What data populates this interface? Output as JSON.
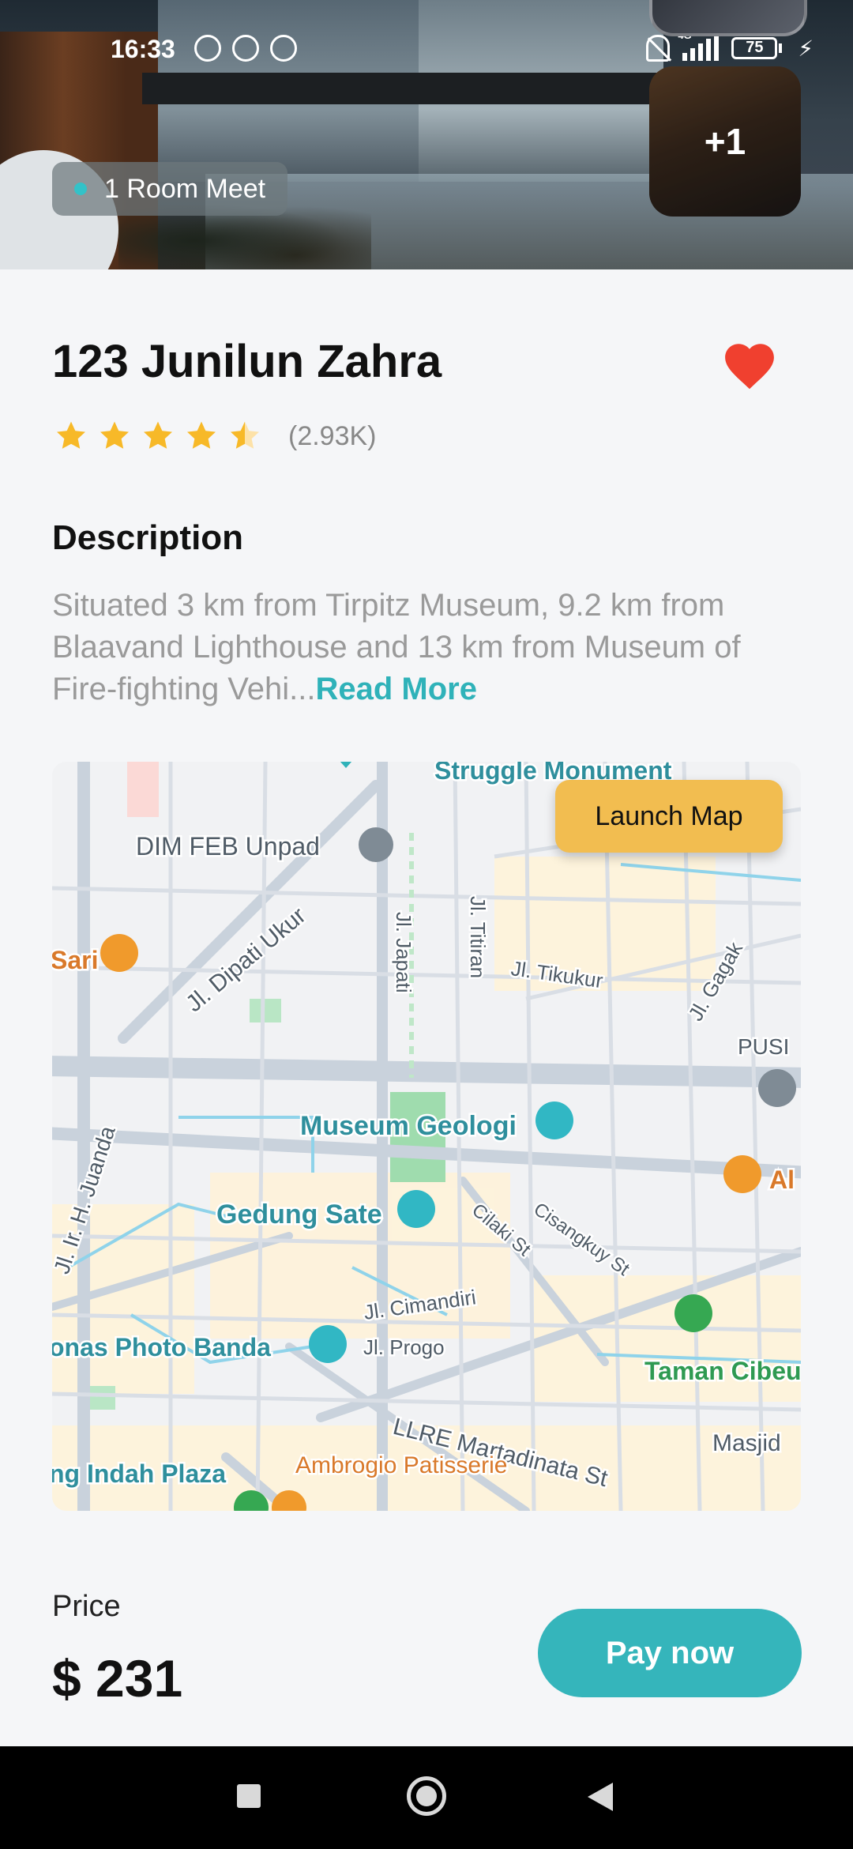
{
  "status_bar": {
    "time": "16:33",
    "network": "4G",
    "battery": "75",
    "battery_level": 0.75
  },
  "hero": {
    "room_label": "1 Room Meet",
    "more_photos": "+1"
  },
  "listing": {
    "title": "123 Junilun Zahra",
    "favorite": true,
    "rating": 4.5,
    "rating_count": "(2.93K)",
    "description_heading": "Description",
    "description_text": "Situated 3 km from Tirpitz Museum, 9.2 km from Blaavand Lighthouse and 13 km from Museum of Fire-fighting Vehi...",
    "read_more": "Read More"
  },
  "map": {
    "launch_label": "Launch Map",
    "places": {
      "struggle": "Struggle Monument",
      "dim_feb": "DIM FEB Unpad",
      "sari": "Sari",
      "dipati": "Jl. Dipati Ukur",
      "japati": "Jl. Japati",
      "titiran": "Jl. Titiran",
      "tikukur": "Jl. Tikukur",
      "gagak": "Jl. Gagak",
      "pusi": "PUSI",
      "museum": "Museum Geologi",
      "al": "Al",
      "juanda": "Jl. Ir. H. Juanda",
      "gedung": "Gedung Sate",
      "cilaki": "Cilaki St",
      "cisangkuy": "Cisangkuy St",
      "cimandiri": "Jl. Cimandiri",
      "progo": "Jl. Progo",
      "photo": "onas Photo Banda",
      "taman": "Taman Cibeunying",
      "martadinata": "LLRE Martadinata St",
      "masjid": "Masjid",
      "plaza": "ng Indah Plaza",
      "ambrogio": "Ambrogio Patisserie"
    }
  },
  "footer": {
    "price_label": "Price",
    "price": "$ 231",
    "pay_label": "Pay now"
  },
  "colors": {
    "accent": "#35b5bb",
    "launch": "#f2bd50",
    "heart": "#f0402f",
    "star": "#f7b928"
  }
}
